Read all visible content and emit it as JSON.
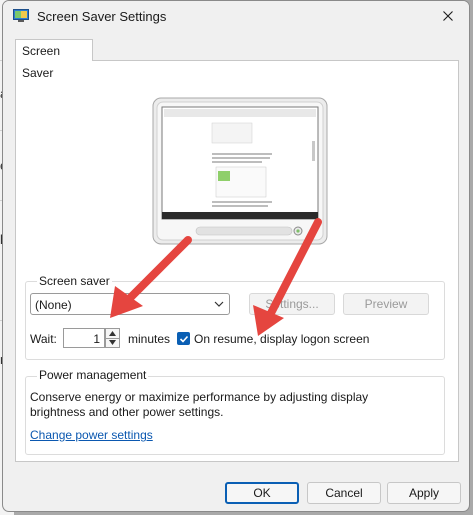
{
  "window": {
    "title": "Screen Saver Settings",
    "icon": "monitor-settings-icon",
    "close_icon": "close-icon"
  },
  "background_window": {
    "chars": [
      "a",
      "e",
      "ll",
      "n"
    ]
  },
  "tabs": [
    {
      "label": "Screen Saver"
    }
  ],
  "screen_saver": {
    "group_label": "Screen saver",
    "selected": "(None)",
    "settings_label": "Settings...",
    "preview_label": "Preview",
    "wait_label": "Wait:",
    "wait_value": "1",
    "minutes_label": "minutes",
    "resume_checked": true,
    "resume_label": "On resume, display logon screen"
  },
  "power": {
    "group_label": "Power management",
    "description": "Conserve energy or maximize performance by adjusting display brightness and other power settings.",
    "link": "Change power settings"
  },
  "footer": {
    "ok": "OK",
    "cancel": "Cancel",
    "apply": "Apply"
  },
  "colors": {
    "accent": "#0a5fb4",
    "annotation_arrow": "#e5453f"
  }
}
